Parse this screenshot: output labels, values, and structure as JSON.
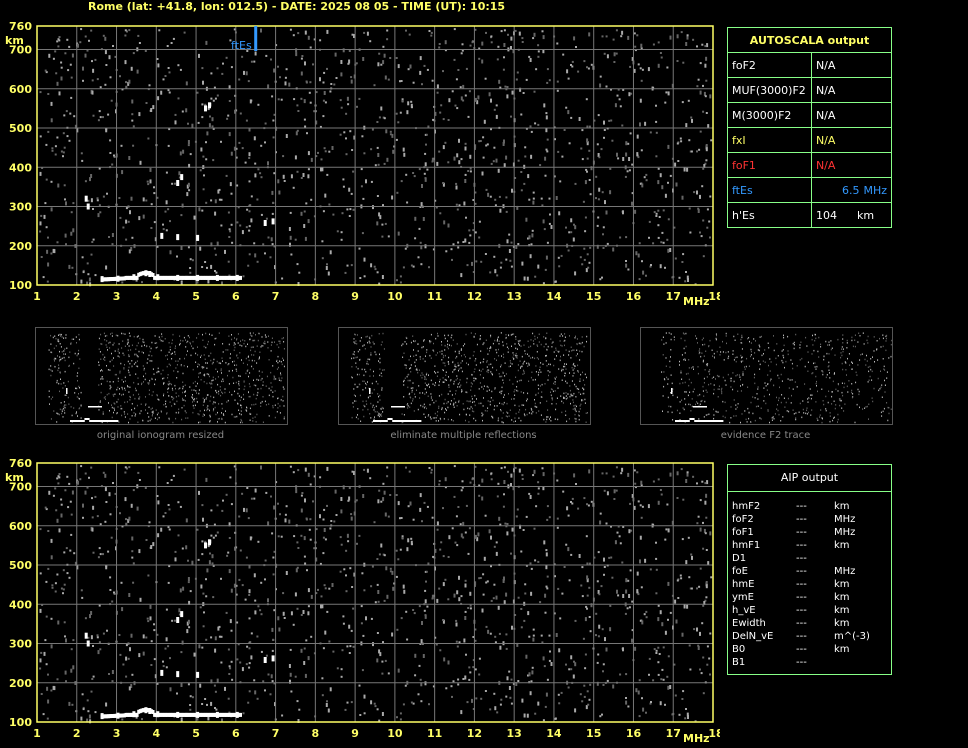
{
  "header": "Rome (lat: +41.8, lon: 012.5) - DATE: 2025 08 05 - TIME (UT): 10:15",
  "chart_data": [
    {
      "type": "scatter",
      "title": "",
      "xlabel": "MHz",
      "ylabel": "km",
      "xlim": [
        1,
        18
      ],
      "ylim": [
        100,
        760
      ],
      "xticks": [
        "1",
        "2",
        "3",
        "4",
        "5",
        "6",
        "7",
        "8",
        "9",
        "10",
        "11",
        "12",
        "13",
        "14",
        "15",
        "16",
        "17",
        "18"
      ],
      "yticks": [
        "100",
        "200",
        "300",
        "400",
        "500",
        "600",
        "700",
        "760"
      ],
      "grid": true,
      "annotations": [
        {
          "text": "ftEs",
          "x": 6.5
        }
      ],
      "series": [
        {
          "values": [
            [
              2.6,
              115
            ],
            [
              3.0,
              116
            ],
            [
              3.4,
              120
            ],
            [
              3.7,
              130
            ],
            [
              3.8,
              128
            ],
            [
              4.0,
              120
            ],
            [
              4.5,
              118
            ],
            [
              5.0,
              118
            ],
            [
              5.5,
              118
            ],
            [
              6.0,
              118
            ],
            [
              2.2,
              320
            ],
            [
              2.25,
              300
            ],
            [
              4.5,
              360
            ],
            [
              4.6,
              375
            ],
            [
              4.1,
              225
            ],
            [
              4.5,
              222
            ],
            [
              5.0,
              220
            ],
            [
              6.7,
              258
            ],
            [
              6.9,
              262
            ],
            [
              5.2,
              550
            ],
            [
              5.3,
              558
            ]
          ]
        }
      ]
    },
    {
      "type": "scatter",
      "title": "",
      "xlabel": "MHz",
      "ylabel": "km",
      "xlim": [
        1,
        18
      ],
      "ylim": [
        100,
        760
      ],
      "xticks": [
        "1",
        "2",
        "3",
        "4",
        "5",
        "6",
        "7",
        "8",
        "9",
        "10",
        "11",
        "12",
        "13",
        "14",
        "15",
        "16",
        "17",
        "18"
      ],
      "yticks": [
        "100",
        "200",
        "300",
        "400",
        "500",
        "600",
        "700",
        "760"
      ],
      "grid": true,
      "series": [
        {
          "values": [
            [
              2.6,
              115
            ],
            [
              3.0,
              116
            ],
            [
              3.4,
              120
            ],
            [
              3.7,
              130
            ],
            [
              3.8,
              128
            ],
            [
              4.0,
              120
            ],
            [
              4.5,
              118
            ],
            [
              5.0,
              118
            ],
            [
              5.5,
              118
            ],
            [
              6.0,
              118
            ],
            [
              2.2,
              320
            ],
            [
              2.25,
              300
            ],
            [
              4.5,
              360
            ],
            [
              4.6,
              375
            ],
            [
              4.1,
              225
            ],
            [
              4.5,
              222
            ],
            [
              5.0,
              220
            ],
            [
              6.7,
              258
            ],
            [
              6.9,
              262
            ],
            [
              5.2,
              550
            ],
            [
              5.3,
              558
            ]
          ]
        }
      ]
    }
  ],
  "autoscala": {
    "title": "AUTOSCALA output",
    "rows": [
      {
        "label": "foF2",
        "value": "N/A",
        "unit": "",
        "color": "#ffffff"
      },
      {
        "label": "MUF(3000)F2",
        "value": "N/A",
        "unit": "",
        "color": "#ffffff"
      },
      {
        "label": "M(3000)F2",
        "value": "N/A",
        "unit": "",
        "color": "#ffffff"
      },
      {
        "label": "fxI",
        "value": "N/A",
        "unit": "",
        "color": "#ffff66"
      },
      {
        "label": "foF1",
        "value": "N/A",
        "unit": "",
        "color": "#ff3333"
      },
      {
        "label": "ftEs",
        "value": "6.5",
        "unit": "MHz",
        "color": "#3399ff"
      },
      {
        "label": "h'Es",
        "value": "104",
        "unit": "km",
        "color": "#ffffff"
      }
    ]
  },
  "aip": {
    "title": "AIP output",
    "rows": [
      {
        "label": "hmF2",
        "value": "---",
        "unit": "km"
      },
      {
        "label": "foF2",
        "value": "---",
        "unit": "MHz"
      },
      {
        "label": "foF1",
        "value": "---",
        "unit": "MHz"
      },
      {
        "label": "hmF1",
        "value": "---",
        "unit": "km"
      },
      {
        "label": "D1",
        "value": "---",
        "unit": ""
      },
      {
        "label": "foE",
        "value": "---",
        "unit": "MHz"
      },
      {
        "label": "hmE",
        "value": "---",
        "unit": "km"
      },
      {
        "label": "ymE",
        "value": "---",
        "unit": "km"
      },
      {
        "label": "h_vE",
        "value": "---",
        "unit": "km"
      },
      {
        "label": "Ewidth",
        "value": "---",
        "unit": "km"
      },
      {
        "label": "DelN_vE",
        "value": "---",
        "unit": "m^(-3)"
      },
      {
        "label": "B0",
        "value": "---",
        "unit": "km"
      },
      {
        "label": "B1",
        "value": "---",
        "unit": ""
      }
    ]
  },
  "thumbnails": [
    {
      "caption": "original ionogram resized"
    },
    {
      "caption": "eliminate multiple reflections"
    },
    {
      "caption": "evidence F2 trace"
    }
  ]
}
